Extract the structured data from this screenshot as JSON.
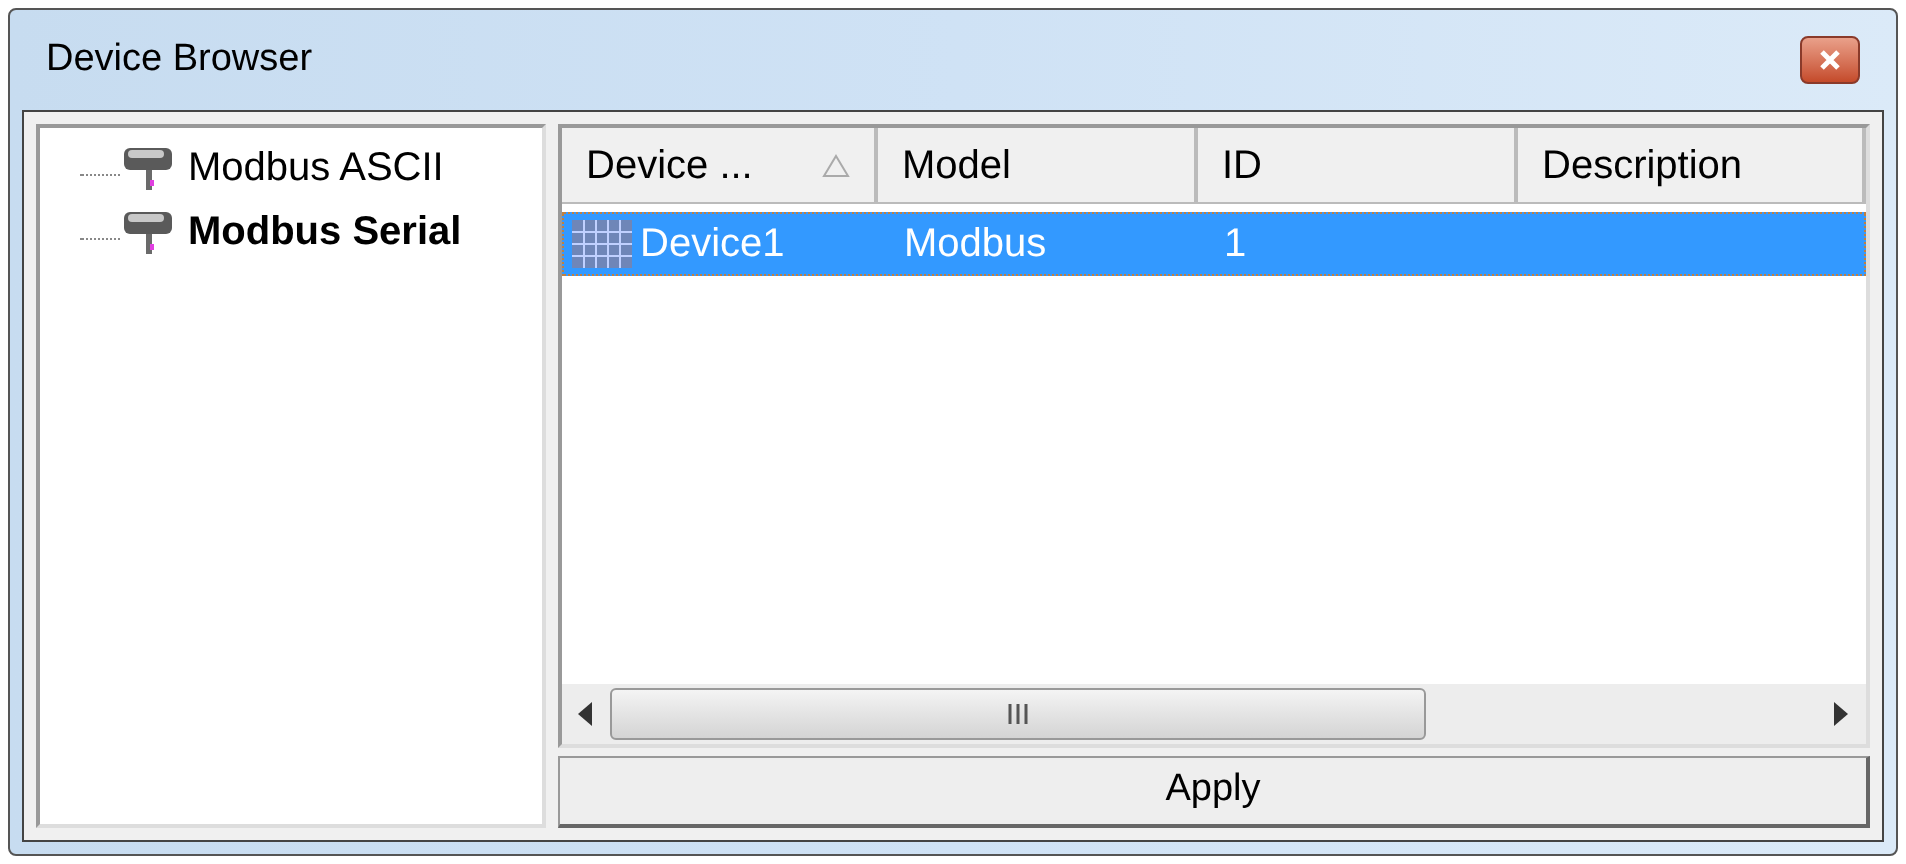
{
  "window": {
    "title": "Device Browser"
  },
  "tree": {
    "items": [
      {
        "label": "Modbus ASCII",
        "selected": false
      },
      {
        "label": "Modbus Serial",
        "selected": true
      }
    ]
  },
  "table": {
    "columns": [
      {
        "label": "Device ...",
        "sorted": true
      },
      {
        "label": "Model",
        "sorted": false
      },
      {
        "label": "ID",
        "sorted": false
      },
      {
        "label": "Description",
        "sorted": false
      }
    ],
    "rows": [
      {
        "cells": [
          "Device1",
          "Modbus",
          "1",
          ""
        ],
        "selected": true
      }
    ]
  },
  "apply_button": {
    "label": "Apply"
  }
}
